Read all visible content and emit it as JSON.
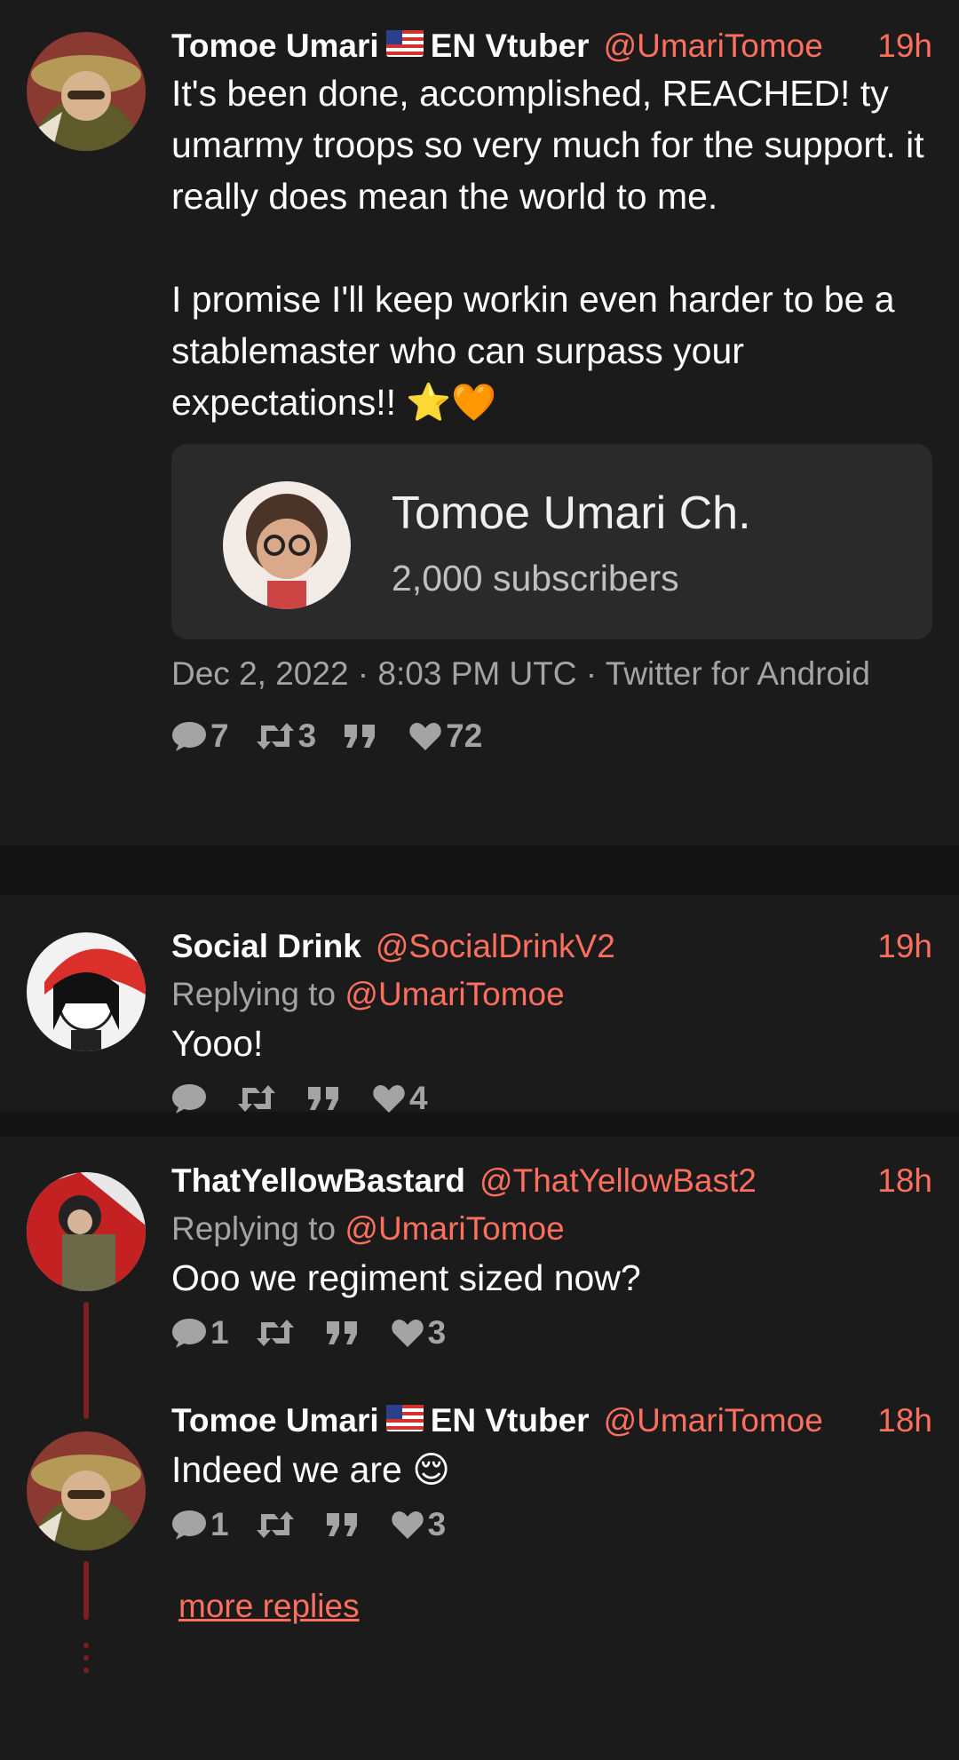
{
  "main_tweet": {
    "fullname": "Tomoe Umari",
    "name_suffix": "EN Vtuber",
    "handle": "@UmariTomoe",
    "time": "19h",
    "text_p1": "It's been done, accomplished, REACHED! ty umarmy troops so very much for the support. it really does mean the world to me.",
    "text_p2": "I promise I'll keep workin even harder to be a stablemaster who can surpass your expectations!! ⭐🧡",
    "embed": {
      "title": "Tomoe Umari Ch.",
      "subtitle": "2,000 subscribers"
    },
    "date": "Dec 2, 2022 · 8:03 PM UTC · Twitter for Android",
    "stats": {
      "replies": "7",
      "retweets": "3",
      "quotes": "",
      "likes": "72"
    }
  },
  "replies": [
    {
      "fullname": "Social Drink",
      "handle": "@SocialDrinkV2",
      "time": "19h",
      "replying_label": "Replying to",
      "replying_to": "@UmariTomoe",
      "text": "Yooo!",
      "stats": {
        "replies": "",
        "retweets": "",
        "quotes": "",
        "likes": "4"
      }
    },
    {
      "fullname": "ThatYellowBastard",
      "handle": "@ThatYellowBast2",
      "time": "18h",
      "replying_label": "Replying to",
      "replying_to": "@UmariTomoe",
      "text": "Ooo we regiment sized now?",
      "stats": {
        "replies": "1",
        "retweets": "",
        "quotes": "",
        "likes": "3"
      }
    },
    {
      "fullname": "Tomoe Umari",
      "name_suffix": "EN Vtuber",
      "handle": "@UmariTomoe",
      "time": "18h",
      "text": "Indeed we are 😌",
      "stats": {
        "replies": "1",
        "retweets": "",
        "quotes": "",
        "likes": "3"
      }
    }
  ],
  "more_replies": "more replies",
  "colors": {
    "accent": "#ff6f5e",
    "background": "#1b1b1c",
    "muted": "#a4a4a4",
    "thread_line": "#7a2020"
  }
}
